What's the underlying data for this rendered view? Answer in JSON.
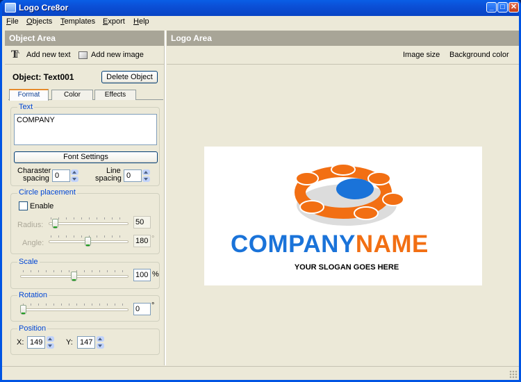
{
  "window": {
    "title": "Logo Cre8or",
    "minimize": "_",
    "maximize": "□",
    "close": "✕"
  },
  "menu": [
    "File",
    "Objects",
    "Templates",
    "Export",
    "Help"
  ],
  "left_pane": {
    "header": "Object Area",
    "add_text": "Add new text",
    "add_image": "Add new image",
    "object_label": "Object: Text001",
    "delete_button": "Delete Object",
    "tabs": [
      "Format",
      "Color",
      "Effects"
    ],
    "active_tab": "Format",
    "text_group": {
      "title": "Text",
      "value": "COMPANY",
      "font_button": "Font Settings"
    },
    "char_spacing": {
      "label_1": "Charaster",
      "label_2": "spacing",
      "value": "0"
    },
    "line_spacing": {
      "label_1": "Line",
      "label_2": "spacing",
      "value": "0"
    },
    "circle_group": {
      "title": "Circle placement",
      "enable_label": "Enable",
      "radius_label": "Radius:",
      "radius_value": "50",
      "radius_level": 0.05,
      "angle_label": "Angle:",
      "angle_value": "180",
      "angle_unit": "°",
      "angle_level": 0.5
    },
    "scale_group": {
      "title": "Scale",
      "value": "100",
      "unit": "%",
      "level": 0.5
    },
    "rotation_group": {
      "title": "Rotation",
      "value": "0",
      "unit": "°",
      "level": 0.0
    },
    "position_group": {
      "title": "Position",
      "x_label": "X:",
      "x_value": "149",
      "y_label": "Y:",
      "y_value": "147"
    }
  },
  "right_pane": {
    "header": "Logo Area",
    "image_size": "Image size",
    "background_color": "Background color"
  },
  "logo": {
    "word1": "COMPANY",
    "word2": "NAME",
    "slogan": "YOUR SLOGAN GOES HERE",
    "colors": {
      "blue": "#1a73d9",
      "orange": "#f26f13",
      "gray": "#c8c8c8"
    }
  }
}
